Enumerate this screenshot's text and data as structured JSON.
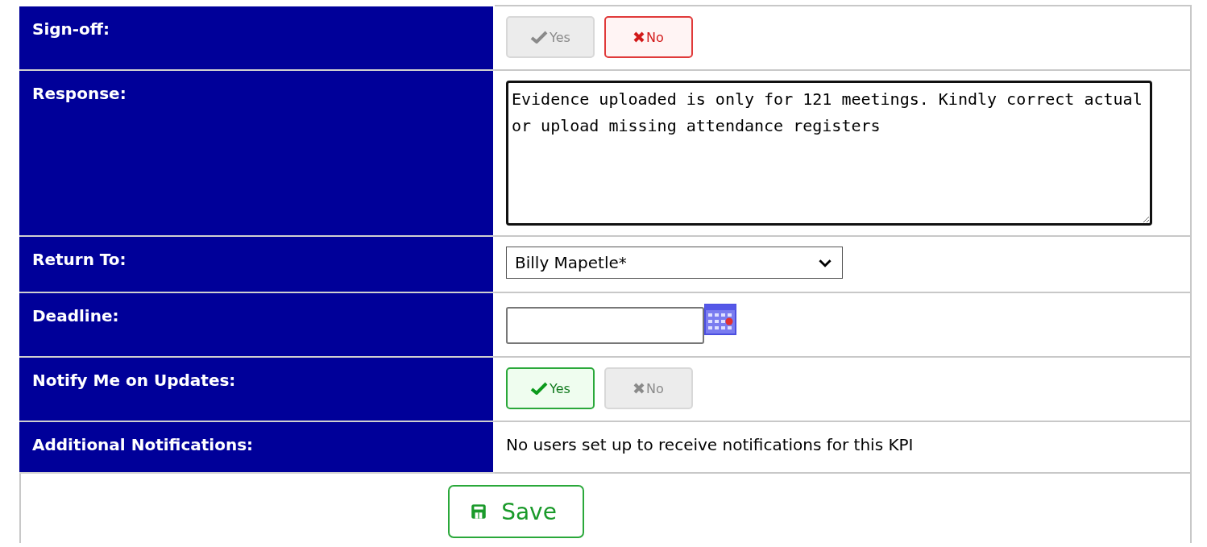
{
  "rows": [
    {
      "label": "Sign-off:",
      "kind": "toggle",
      "options": [
        {
          "label": "Yes",
          "kind": "yes",
          "selected": false
        },
        {
          "label": "No",
          "kind": "no",
          "selected": true
        }
      ]
    },
    {
      "label": "Response:",
      "kind": "textarea",
      "value": "Evidence uploaded is only for 121 meetings. Kindly correct actual or upload missing attendance registers"
    },
    {
      "label": "Return To:",
      "kind": "select",
      "value": "Billy Mapetle*"
    },
    {
      "label": "Deadline:",
      "kind": "date"
    },
    {
      "label": "Notify Me on Updates:",
      "kind": "toggle",
      "options": [
        {
          "label": "Yes",
          "kind": "yes",
          "selected": true
        },
        {
          "label": "No",
          "kind": "no",
          "selected": false
        }
      ]
    },
    {
      "label": "Additional Notifications:",
      "kind": "text",
      "value": "No users set up to receive notifications for this KPI"
    }
  ],
  "save_button": "Save"
}
